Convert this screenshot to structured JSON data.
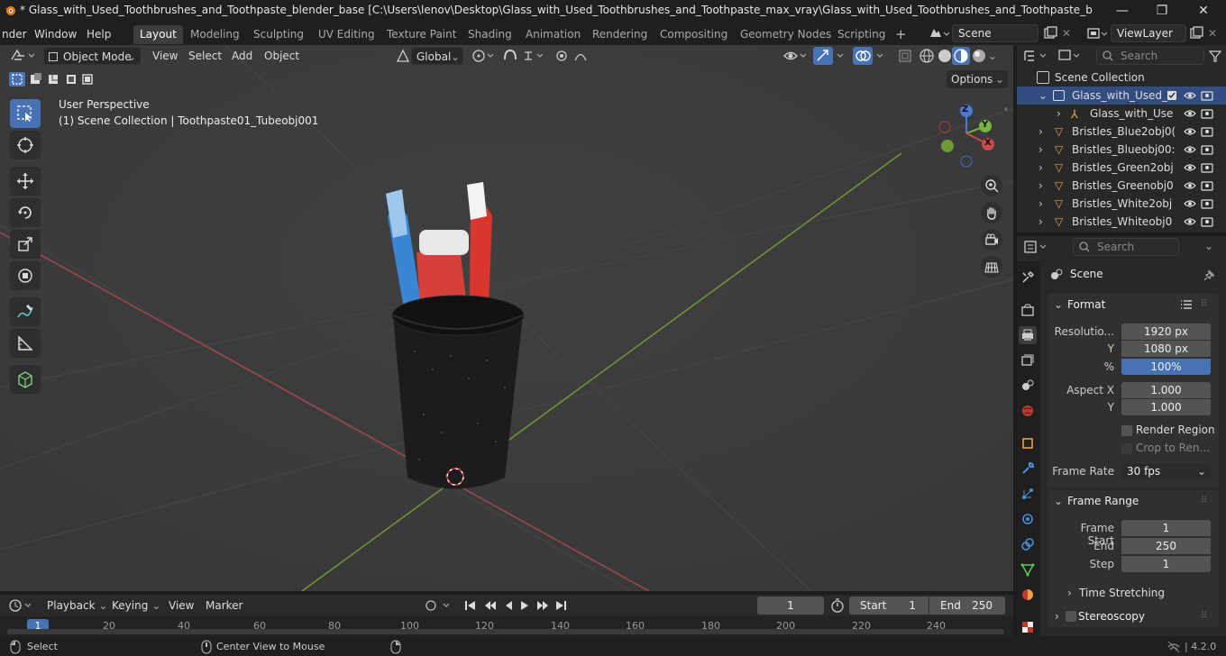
{
  "titlebar": {
    "title": "* Glass_with_Used_Toothbrushes_and_Toothpaste_blender_base [C:\\Users\\lenov\\Desktop\\Glass_with_Used_Toothbrushes_and_Toothpaste_max_vray\\Glass_with_Used_Toothbrushes_and_Toothpaste_blender_base.blend] - Blend...",
    "minimize": "—",
    "maximize": "❐",
    "close": "✕"
  },
  "menubar": {
    "items": [
      "nder",
      "Window",
      "Help"
    ],
    "workspaces": [
      "Layout",
      "Modeling",
      "Sculpting",
      "UV Editing",
      "Texture Paint",
      "Shading",
      "Animation",
      "Rendering",
      "Compositing",
      "Geometry Nodes",
      "Scripting"
    ],
    "active_workspace": "Layout",
    "add_tab": "+",
    "scene": "Scene",
    "view_layer": "ViewLayer"
  },
  "viewport_header": {
    "mode": "Object Mode",
    "menus": [
      "View",
      "Select",
      "Add",
      "Object"
    ],
    "transform_orientation": "Global",
    "options": "Options"
  },
  "viewport": {
    "perspective_label": "User Perspective",
    "context_label": "(1) Scene Collection | Toothpaste01_Tubeobj001",
    "gizmo_axes": [
      "Z",
      "Y",
      "X"
    ]
  },
  "outliner": {
    "search_placeholder": "Search",
    "root": "Scene Collection",
    "rows": [
      {
        "label": "Glass_with_Used_T",
        "indent": 1
      },
      {
        "label": "Glass_with_Use",
        "indent": 2
      },
      {
        "label": "Bristles_Blue2obj0(",
        "indent": 1
      },
      {
        "label": "Bristles_Blueobj00:",
        "indent": 1
      },
      {
        "label": "Bristles_Green2obj",
        "indent": 1
      },
      {
        "label": "Bristles_Greenobj0",
        "indent": 1
      },
      {
        "label": "Bristles_White2obj",
        "indent": 1
      },
      {
        "label": "Bristles_Whiteobj0",
        "indent": 1
      }
    ]
  },
  "properties": {
    "search_placeholder": "Search",
    "context": "Scene",
    "format": {
      "title": "Format",
      "resolution_x_label": "Resolutio...",
      "resolution_x": "1920 px",
      "resolution_y_label": "Y",
      "resolution_y": "1080 px",
      "percent_label": "%",
      "percent": "100%",
      "percent_fraction": 1.0,
      "aspect_x_label": "Aspect X",
      "aspect_x": "1.000",
      "aspect_y_label": "Y",
      "aspect_y": "1.000",
      "render_region": "Render Region",
      "crop": "Crop to Ren...",
      "frame_rate_label": "Frame Rate",
      "frame_rate": "30 fps"
    },
    "frame_range": {
      "title": "Frame Range",
      "start_label": "Frame Start",
      "start": "1",
      "end_label": "End",
      "end": "250",
      "step_label": "Step",
      "step": "1"
    },
    "time_stretching": "Time Stretching",
    "stereoscopy": "Stereoscopy"
  },
  "timeline": {
    "menus": [
      "Playback",
      "Keying",
      "View",
      "Marker"
    ],
    "current_frame": "1",
    "start_label": "Start",
    "start": "1",
    "end_label": "End",
    "end": "250",
    "ticks": [
      "1",
      "20",
      "40",
      "60",
      "80",
      "100",
      "120",
      "140",
      "160",
      "180",
      "200",
      "220",
      "240"
    ]
  },
  "statusbar": {
    "select": "Select",
    "center_view": "Center View to Mouse",
    "version": "4.2.0"
  },
  "colors": {
    "accent": "#4772b3",
    "x_axis": "#c84a4a",
    "y_axis": "#7ab33f",
    "z_axis": "#4a7ad6"
  }
}
